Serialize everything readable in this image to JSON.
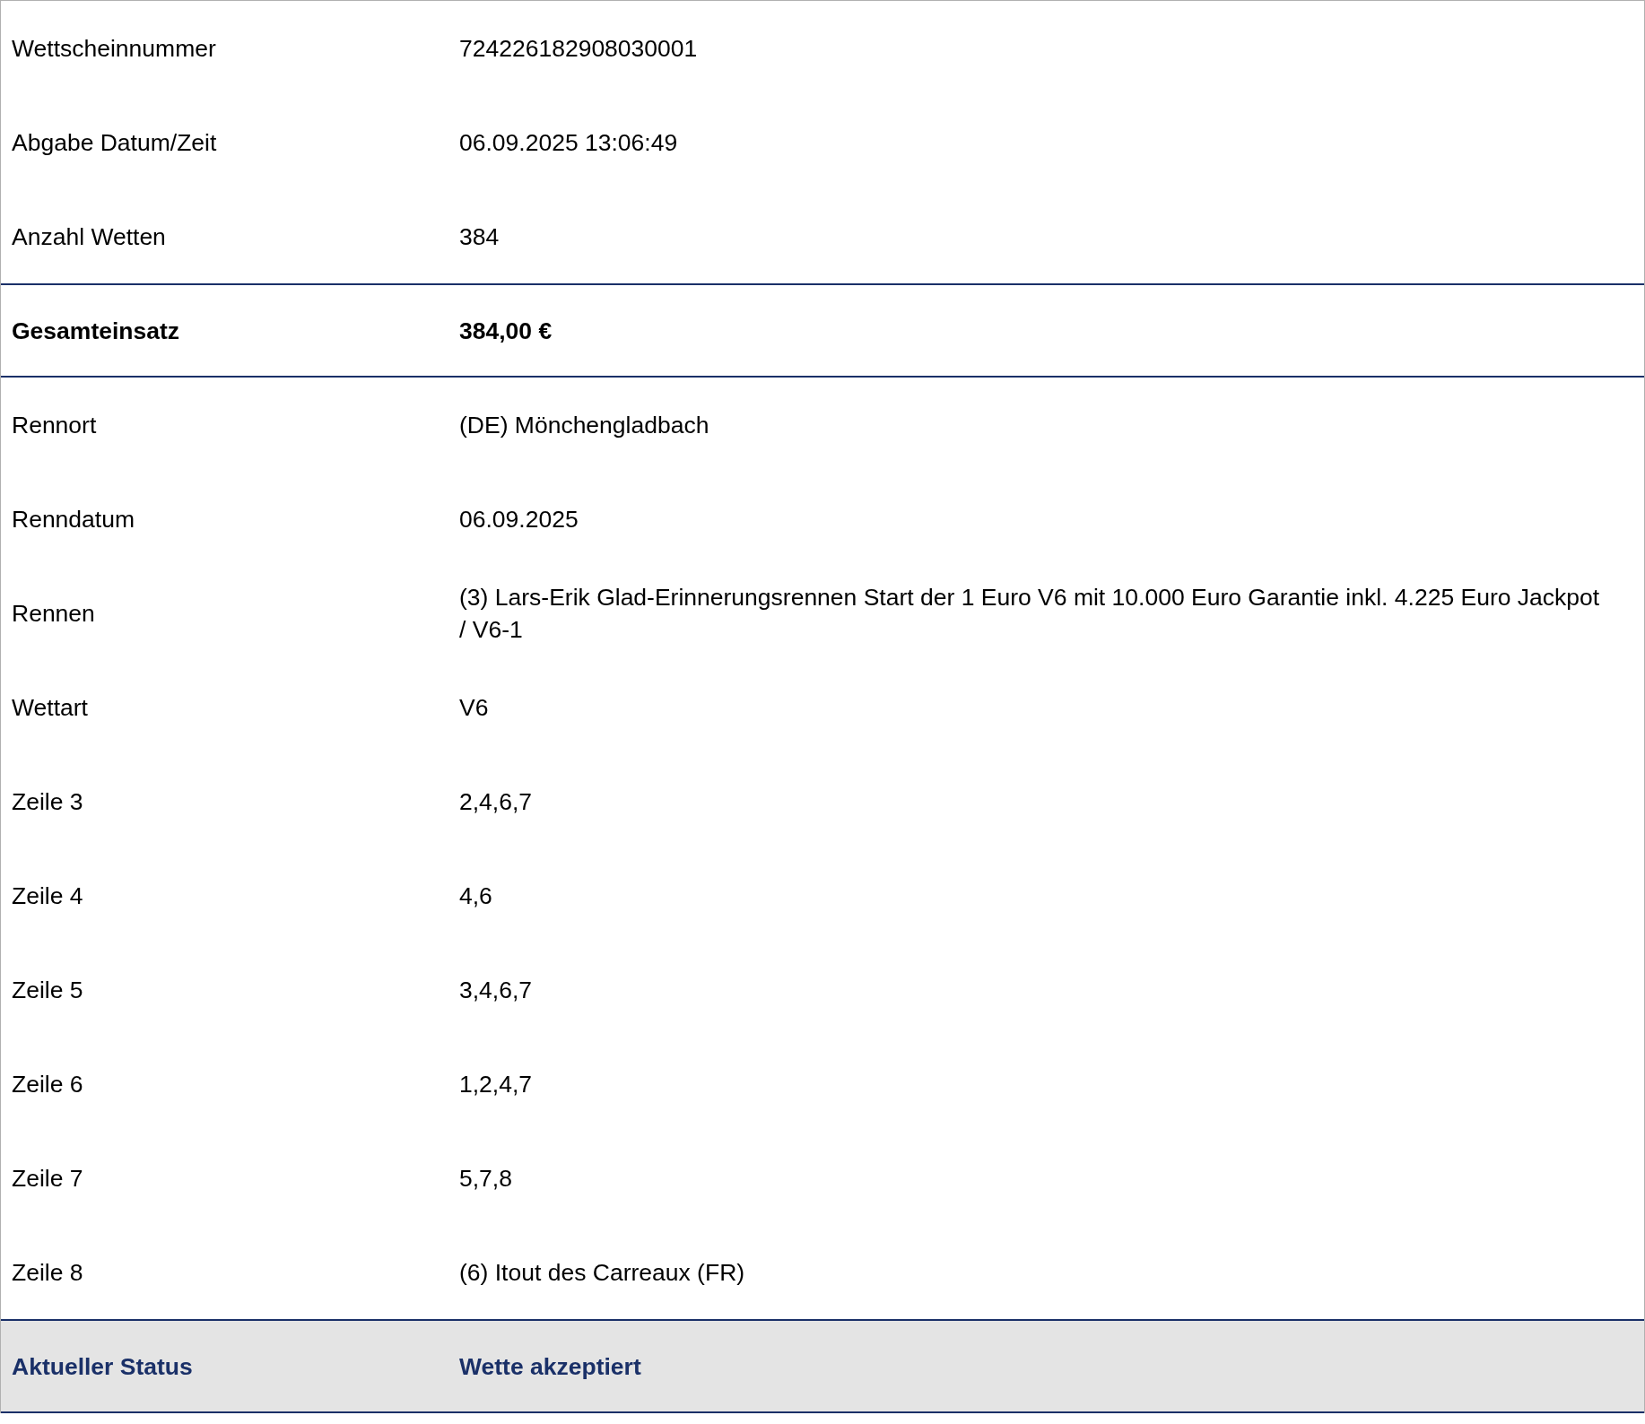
{
  "rows": [
    {
      "kind": "detail",
      "label": "Wettscheinnummer",
      "value": "724226182908030001"
    },
    {
      "kind": "detail",
      "label": "Abgabe Datum/Zeit",
      "value": "06.09.2025 13:06:49"
    },
    {
      "kind": "detail",
      "label": "Anzahl Wetten",
      "value": "384"
    },
    {
      "kind": "total",
      "label": "Gesamteinsatz",
      "value": "384,00 €"
    },
    {
      "kind": "detail",
      "label": "Rennort",
      "value": "(DE) Mönchengladbach"
    },
    {
      "kind": "detail",
      "label": "Renndatum",
      "value": "06.09.2025"
    },
    {
      "kind": "detail",
      "label": "Rennen",
      "value": "(3) Lars-Erik Glad-Erinnerungsrennen Start der 1 Euro V6 mit 10.000 Euro Garantie inkl. 4.225 Euro Jackpot / V6-1"
    },
    {
      "kind": "detail",
      "label": "Wettart",
      "value": "V6"
    },
    {
      "kind": "detail",
      "label": "Zeile 3",
      "value": "2,4,6,7"
    },
    {
      "kind": "detail",
      "label": "Zeile 4",
      "value": "4,6"
    },
    {
      "kind": "detail",
      "label": "Zeile 5",
      "value": "3,4,6,7"
    },
    {
      "kind": "detail",
      "label": "Zeile 6",
      "value": "1,2,4,7"
    },
    {
      "kind": "detail",
      "label": "Zeile 7",
      "value": "5,7,8"
    },
    {
      "kind": "detail",
      "label": "Zeile 8",
      "value": "(6) Itout des Carreaux (FR)"
    },
    {
      "kind": "status",
      "label": "Aktueller Status",
      "value": "Wette akzeptiert"
    }
  ]
}
